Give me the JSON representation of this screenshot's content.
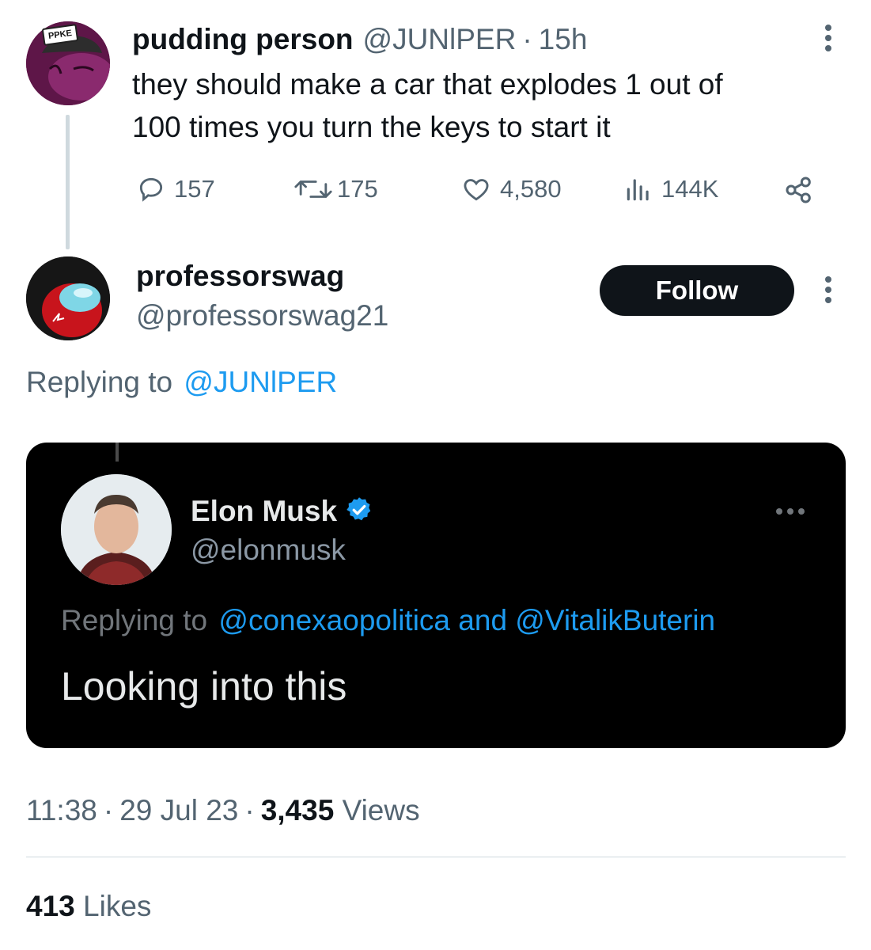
{
  "parent_tweet": {
    "avatar_badge": "PPKE",
    "display_name": "pudding person",
    "handle": "@JUNlPER",
    "separator": "·",
    "time": "15h",
    "text_line1": "they should make a car that explodes 1 out of",
    "text_line2": "100 times you turn the keys to start it",
    "replies": "157",
    "retweets": "175",
    "likes": "4,580",
    "views": "144K",
    "icons": [
      "reply-icon",
      "retweet-icon",
      "heart-icon",
      "views-icon",
      "share-icon",
      "more-vertical-icon"
    ]
  },
  "reply_tweet": {
    "display_name": "professorswag",
    "handle": "@professorswag21",
    "follow_label": "Follow",
    "replying_prefix": "Replying to",
    "replying_handle": "@JUNlPER"
  },
  "embedded_image": {
    "display_name": "Elon Musk",
    "handle": "@elonmusk",
    "replying_prefix": "Replying to",
    "replying_handles": "@conexaopolitica and @VitalikButerin",
    "text": "Looking into this",
    "colors": {
      "background": "#000000",
      "verified": "#1d9bf0"
    }
  },
  "meta": {
    "time": "11:38",
    "sep1": "·",
    "date": "29 Jul 23",
    "sep2": "·",
    "views_count": "3,435",
    "views_label": "Views",
    "likes_count": "413",
    "likes_label": "Likes"
  },
  "colors": {
    "text": "#0f1419",
    "muted": "#536471",
    "link": "#1d9bf0",
    "button": "#0f1419"
  }
}
